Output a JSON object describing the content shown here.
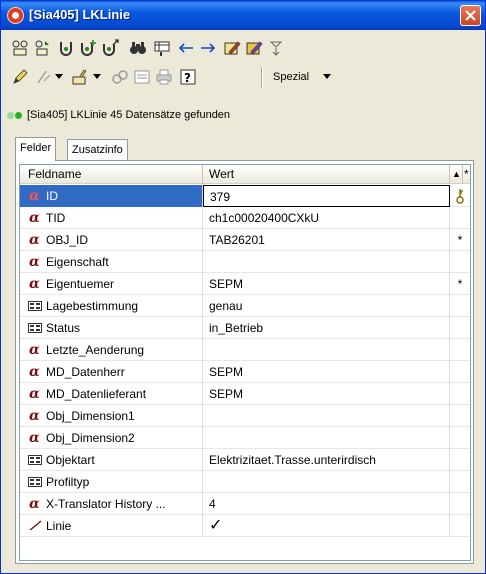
{
  "window": {
    "title": "[Sia405] LKLinie"
  },
  "toolbar2": {
    "spezial_label": "Spezial"
  },
  "status": {
    "text": "[Sia405] LKLinie    45 Datensätze gefunden"
  },
  "tabs": [
    {
      "label": "Felder",
      "active": true
    },
    {
      "label": "Zusatzinfo",
      "active": false
    }
  ],
  "grid": {
    "headers": {
      "name": "Feldname",
      "value": "Wert",
      "sort": "▲",
      "star": "*"
    },
    "rows": [
      {
        "icon": "alpha-icon",
        "name": "ID",
        "value": "379",
        "flag": "key-icon",
        "selected": true
      },
      {
        "icon": "alpha-icon",
        "name": "TID",
        "value": "ch1c00020400CXkU",
        "flag": ""
      },
      {
        "icon": "alpha-icon",
        "name": "OBJ_ID",
        "value": "TAB26201",
        "flag": "*"
      },
      {
        "icon": "alpha-icon",
        "name": "Eigenschaft",
        "value": "",
        "flag": ""
      },
      {
        "icon": "alpha-icon",
        "name": "Eigentuemer",
        "value": "SEPM",
        "flag": "*"
      },
      {
        "icon": "list-icon",
        "name": "Lagebestimmung",
        "value": "genau",
        "flag": ""
      },
      {
        "icon": "list-icon",
        "name": "Status",
        "value": "in_Betrieb",
        "flag": ""
      },
      {
        "icon": "alpha-icon",
        "name": "Letzte_Aenderung",
        "value": "",
        "flag": ""
      },
      {
        "icon": "alpha-icon",
        "name": "MD_Datenherr",
        "value": "SEPM",
        "flag": ""
      },
      {
        "icon": "alpha-icon",
        "name": "MD_Datenlieferant",
        "value": "SEPM",
        "flag": ""
      },
      {
        "icon": "alpha-icon",
        "name": "Obj_Dimension1",
        "value": "",
        "flag": ""
      },
      {
        "icon": "alpha-icon",
        "name": "Obj_Dimension2",
        "value": "",
        "flag": ""
      },
      {
        "icon": "list-icon",
        "name": "Objektart",
        "value": "Elektrizitaet.Trasse.unterirdisch",
        "flag": ""
      },
      {
        "icon": "list-icon",
        "name": "Profiltyp",
        "value": "",
        "flag": ""
      },
      {
        "icon": "alpha-icon",
        "name": "X-Translator History ...",
        "value": "4",
        "flag": ""
      },
      {
        "icon": "line-icon",
        "name": "Linie",
        "value": "✓",
        "flag": ""
      }
    ]
  },
  "colors": {
    "title_bar": "#0859e0",
    "selection": "#316ac5",
    "status_dot_left": "#9fd89f",
    "status_dot_right": "#22b422"
  }
}
